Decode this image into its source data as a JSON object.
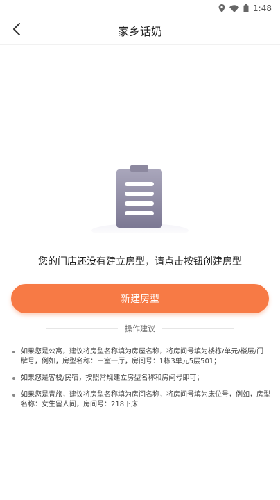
{
  "status_bar": {
    "time": "1:48"
  },
  "app_bar": {
    "title": "家乡话奶"
  },
  "empty_state": {
    "message": "您的门店还没有建立房型，请点击按钮创建房型"
  },
  "actions": {
    "create_label": "新建房型"
  },
  "tips": {
    "title": "操作建议",
    "items": [
      "如果您是公寓，建议将房型名称填为房屋名称，将房间号填为楼栋/单元/楼层/门牌号，例如，房型名称：三室一厅，房间号：1栋3单元5层501；",
      "如果您是客栈/民宿，按照常规建立房型名称和房间号即可；",
      "如果您是青旅，建议将房型名称填为房间名称，将房间号填为床位号，例如，房型名称：女生留人间，房间号：218下床"
    ]
  },
  "colors": {
    "accent": "#f77a45",
    "illustration": "#8e8aa3"
  }
}
